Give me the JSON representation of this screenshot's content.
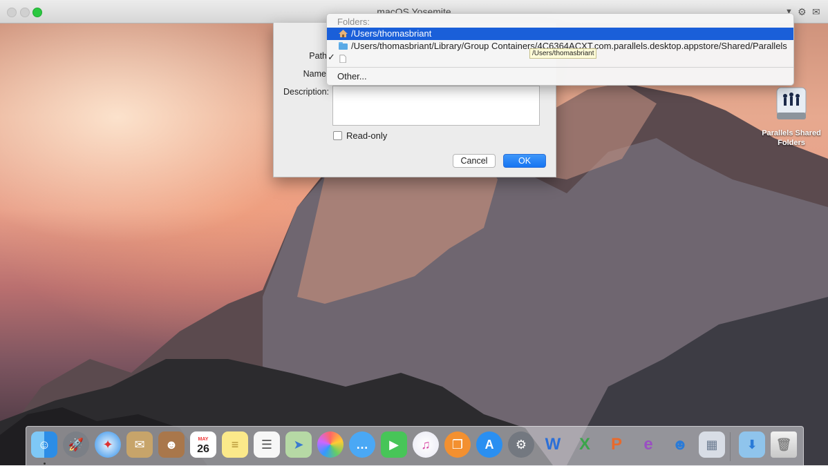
{
  "window": {
    "title": "macOS Yosemite"
  },
  "dialog": {
    "path_label": "Path",
    "name_label": "Name",
    "description_label": "Description:",
    "description_value": "",
    "readonly_label": "Read-only",
    "readonly_checked": false,
    "cancel_label": "Cancel",
    "ok_label": "OK"
  },
  "menu": {
    "header": "Folders:",
    "items": [
      {
        "label": "/Users/thomasbriant",
        "icon": "home-folder-icon",
        "selected": true
      },
      {
        "label": "/Users/thomasbriant/Library/Group Containers/4C6364ACXT.com.parallels.desktop.appstore/Shared/Parallels",
        "icon": "folder-icon",
        "selected": false
      },
      {
        "label": "",
        "icon": "document-icon",
        "checked": true
      }
    ],
    "other": "Other...",
    "tooltip": "/Users/thomasbriant"
  },
  "desktop": {
    "icon_label_line1": "Parallels Shared",
    "icon_label_line2": "Folders"
  },
  "dock": {
    "items": [
      "finder",
      "launchpad",
      "safari",
      "mail",
      "contacts",
      "calendar",
      "notes",
      "reminders",
      "maps",
      "photos",
      "messages",
      "facetime",
      "itunes",
      "ibooks",
      "app-store",
      "system-preferences",
      "word",
      "excel",
      "powerpoint",
      "outlook",
      "lync",
      "keynote-like",
      "downloads",
      "trash"
    ],
    "calendar_month": "MAY",
    "calendar_day": "26"
  },
  "colors": {
    "accent": "#1a5fd9",
    "ok_button": "#1674f2"
  }
}
